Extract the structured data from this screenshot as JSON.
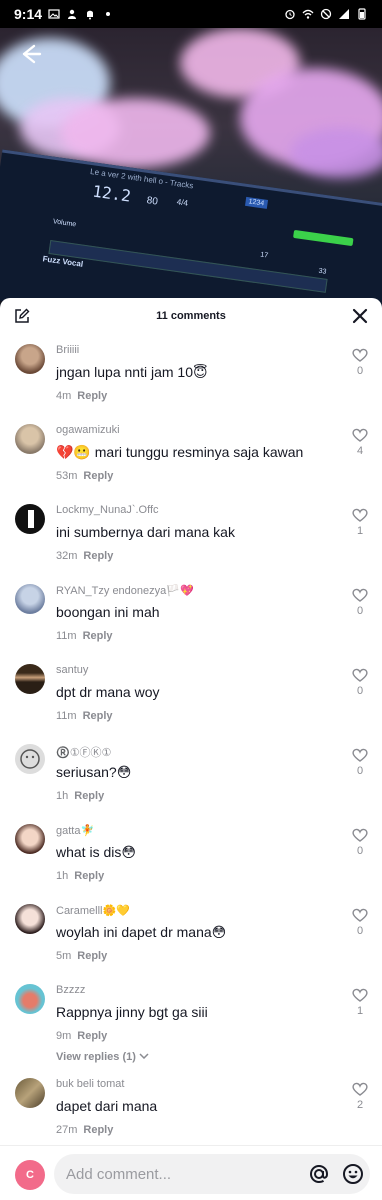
{
  "status_bar": {
    "time": "9:14",
    "left_icons": [
      "gallery-icon",
      "user-icon",
      "notification-icon",
      "dot-icon"
    ],
    "right_icons": [
      "alarm-icon",
      "wifi-icon",
      "block-icon",
      "signal-icon",
      "battery-icon"
    ]
  },
  "video": {
    "daw_tempo": "12.2",
    "daw_bpm": "80",
    "daw_time_sig": "4/4",
    "daw_track_label": "Volume",
    "daw_track2": "Fuzz Vocal",
    "daw_bar": "1234",
    "daw_marker1": "17",
    "daw_marker2": "33",
    "window_title": "Le a ver 2 with hell o - Tracks"
  },
  "sheet": {
    "title": "11 comments"
  },
  "comments": [
    {
      "username": "Briiiii",
      "text": "jngan lupa nnti jam 10",
      "emoji": "😇",
      "time": "4m",
      "reply": "Reply",
      "likes": "0"
    },
    {
      "username": "ogawamizuki",
      "text": "mari tunggu resminya saja kawan",
      "prefix": "💔😬",
      "time": "53m",
      "reply": "Reply",
      "likes": "4"
    },
    {
      "username": "Lockmy_NunaJ`.Offc",
      "text": "ini sumbernya dari mana kak",
      "time": "32m",
      "reply": "Reply",
      "likes": "1"
    },
    {
      "username": "RYAN_Tzy endonezya",
      "username_emoji": "🏳️💖",
      "text": "boongan ini mah",
      "time": "11m",
      "reply": "Reply",
      "likes": "0"
    },
    {
      "username": "santuy",
      "text": "dpt dr mana woy",
      "time": "11m",
      "reply": "Reply",
      "likes": "0"
    },
    {
      "username": "®️①Ⓕ️Ⓚ️①",
      "text": "seriusan?",
      "emoji": "😳",
      "time": "1h",
      "reply": "Reply",
      "likes": "0"
    },
    {
      "username": "gatta",
      "username_emoji": "🧚",
      "text": "what is dis",
      "emoji": "😳",
      "time": "1h",
      "reply": "Reply",
      "likes": "0"
    },
    {
      "username": "Caramelll",
      "username_emoji": "🌼💛",
      "text": "woylah ini dapet dr mana",
      "emoji": "😳",
      "time": "5m",
      "reply": "Reply",
      "likes": "0"
    },
    {
      "username": "Bzzzz",
      "text": "Rappnya jinny bgt ga siii",
      "time": "9m",
      "reply": "Reply",
      "likes": "1",
      "view_replies": "View replies (1)"
    },
    {
      "username": "buk beli tomat",
      "text": "dapet dari mana",
      "time": "27m",
      "reply": "Reply",
      "likes": "2"
    }
  ],
  "input": {
    "avatar_letter": "C",
    "placeholder": "Add comment..."
  },
  "colors": {
    "accent": "#fe2c55",
    "muted": "#8a8b91",
    "text": "#161823",
    "input_bg": "#f1f1f2"
  }
}
